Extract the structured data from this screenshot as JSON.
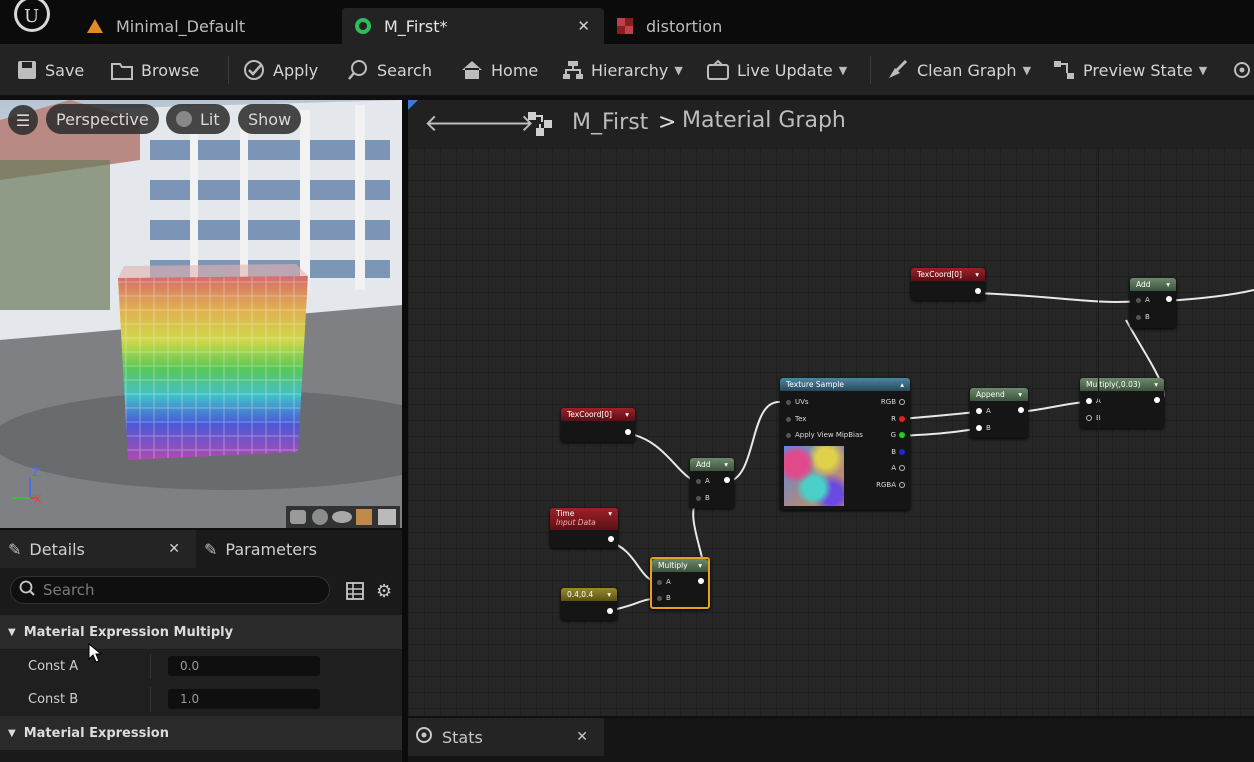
{
  "tabs": [
    {
      "label": "Minimal_Default",
      "icon": "level-icon"
    },
    {
      "label": "M_First*",
      "icon": "material-icon",
      "active": true
    },
    {
      "label": "distortion",
      "icon": "texture-icon"
    }
  ],
  "toolbar": {
    "save": "Save",
    "browse": "Browse",
    "apply": "Apply",
    "search": "Search",
    "home": "Home",
    "hierarchy": "Hierarchy",
    "live_update": "Live Update",
    "clean_graph": "Clean Graph",
    "preview_state": "Preview State"
  },
  "viewport": {
    "perspective": "Perspective",
    "lit": "Lit",
    "show": "Show",
    "axis_z": "Z",
    "axis_x": "X"
  },
  "details": {
    "tab_details": "Details",
    "tab_parameters": "Parameters",
    "search_placeholder": "Search",
    "section1": "Material Expression Multiply",
    "const_a_label": "Const A",
    "const_a_value": "0.0",
    "const_b_label": "Const B",
    "const_b_value": "1.0",
    "section2": "Material Expression"
  },
  "graph": {
    "breadcrumb_root": "M_First",
    "breadcrumb_sep": ">",
    "breadcrumb_current": "Material Graph",
    "nodes": {
      "texcoord_top": "TexCoord[0]",
      "add_top": "Add",
      "texcoord_left": "TexCoord[0]",
      "add_mid": "Add",
      "texture_sample": "Texture Sample",
      "append": "Append",
      "multiply_003": "Multiply(,0.03)",
      "time": "Time",
      "time_sub": "Input Data",
      "multiply": "Multiply",
      "const_04": "0.4,0.4"
    },
    "pins": {
      "a": "A",
      "b": "B",
      "uvs": "UVs",
      "tex": "Tex",
      "apply_mip": "Apply View MipBias",
      "rgb": "RGB",
      "r": "R",
      "g": "G",
      "b_ch": "B",
      "a_ch": "A",
      "rgba": "RGBA"
    }
  },
  "stats": {
    "label": "Stats"
  }
}
